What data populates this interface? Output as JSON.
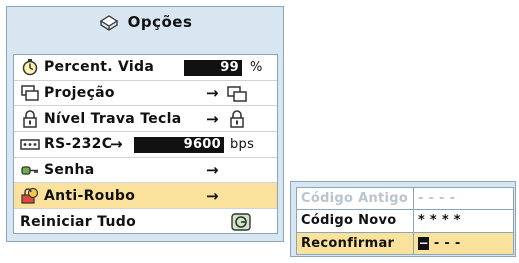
{
  "menu": {
    "title": "Opções",
    "title_icon": "options-icon",
    "items": [
      {
        "label": "Percent. Vida",
        "icon": "timer-icon",
        "value": "99",
        "unit": "%"
      },
      {
        "label": "Projeção",
        "icon": "projection-icon",
        "arrow": "→",
        "right_icon": "projection-icon"
      },
      {
        "label": "Nível Trava Tecla",
        "icon": "lock-icon",
        "arrow": "→",
        "right_icon": "lock-icon"
      },
      {
        "label": "RS-232C",
        "icon": "rs232c-port-icon",
        "arrow": "→",
        "value": "9600",
        "unit": "bps"
      },
      {
        "label": "Senha",
        "icon": "key-icon",
        "arrow": "→"
      },
      {
        "label": "Anti-Roubo",
        "icon": "anti-theft-icon",
        "arrow": "→",
        "selected": true
      },
      {
        "label": "Reiniciar Tudo",
        "right_icon": "reset-icon"
      }
    ]
  },
  "password": {
    "rows": [
      {
        "label": "Código Antigo",
        "value": "- - - -",
        "state": "disabled"
      },
      {
        "label": "Código Novo",
        "value": "* * * *",
        "state": "normal"
      },
      {
        "label": "Reconfirmar",
        "cursor": "−",
        "value": "- - -",
        "state": "active"
      }
    ]
  },
  "colors": {
    "panel_bg": "#d8e6f2",
    "highlight": "#fbe29c",
    "border": "#8aa6bd"
  }
}
